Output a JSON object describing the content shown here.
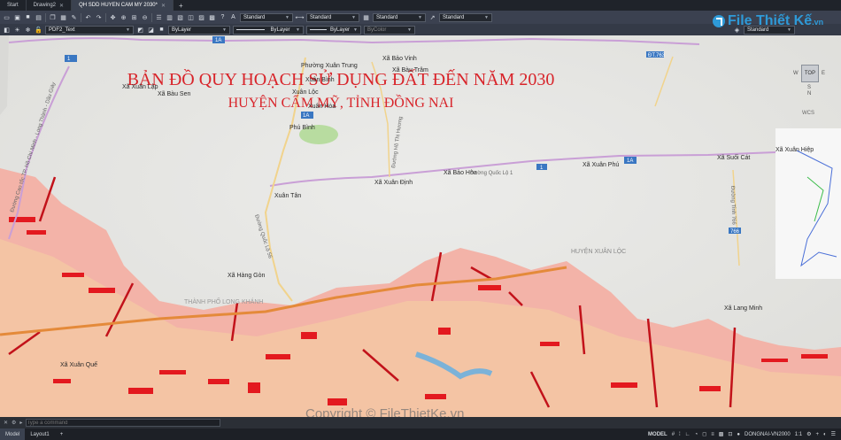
{
  "tabs": [
    {
      "label": "Start",
      "active": false
    },
    {
      "label": "Drawing2",
      "active": false
    },
    {
      "label": "QH SDD HUYEN CAM MY 2030*",
      "active": true
    }
  ],
  "toolbar1": {
    "text_style": "Standard",
    "dim_style": "Standard",
    "table_style": "Standard",
    "mleader_style": "Standard"
  },
  "toolbar2": {
    "layer": "PDF2_Text",
    "color": "ByLayer",
    "linetype": "ByLayer",
    "lineweight": "ByLayer",
    "plotstyle": "ByColor",
    "visual_style": "Standard"
  },
  "map": {
    "title_line1": "BẢN ĐỒ QUY HOẠCH SỬ DỤNG ĐẤT ĐẾN NĂM 2030",
    "title_line2": "HUYỆN CẨM MỸ, TỈNH ĐỒNG NAI",
    "places": {
      "xuan_trung": "Phường Xuân Trung",
      "bao_vinh": "Xã Bảo Vinh",
      "bau_tram": "Xã Bàu Trâm",
      "xuan_binh": "Xuân Bình",
      "xuan_loc": "Xuân Lộc",
      "xuan_hoa": "Xuân Hòa",
      "xuan_lap": "Xã Xuân Lập",
      "bau_sen": "Xã Bàu Sen",
      "phu_binh": "Phú Bình",
      "bao_hoa": "Xã Bảo Hòa",
      "xuan_dinh": "Xã Xuân Định",
      "xuan_phu": "Xã Xuân Phú",
      "suoi_cat": "Xã Suối Cát",
      "xuan_hiep": "Xã Xuân Hiệp",
      "xuan_tan": "Xuân Tân",
      "hang_gon": "Xã Hàng Gòn",
      "lang_minh": "Xã Lang Minh",
      "xuan_quy": "Xã Xuân Quế",
      "huyen_xuan_loc": "HUYỆN XUÂN LỘC",
      "tp_long_khanh": "THÀNH PHỐ LONG KHÁNH"
    },
    "roads": {
      "hcm_long_thanh": "Đường Cao tốc TP. Hồ Chí Minh - Long Thành - Dầu Giây",
      "ho_thi_huong": "Đường Hồ Thị Hương",
      "ql1": "Đường Quốc Lộ 1",
      "ql56": "Đường Quốc Lộ 56",
      "dt763": "ĐT.763",
      "dt766": "Đường Tỉnh 766",
      "shield_1a": "1A",
      "shield_1": "1",
      "shield_766": "766"
    }
  },
  "viewcube": {
    "top": "TOP",
    "n": "N",
    "s": "S",
    "e": "E",
    "w": "W",
    "wcs": "WCS"
  },
  "logo": {
    "brand": "File Thiết Kế",
    "suffix": ".vn"
  },
  "copyright": "Copyright © FileThietKe.vn",
  "command": {
    "placeholder": "Type a command"
  },
  "layout_tabs": [
    "Model",
    "Layout1"
  ],
  "status": {
    "model": "MODEL",
    "coord_system": "DONGNAI-VN2000",
    "scale": "1:1"
  },
  "colors": {
    "accent": "#2e9ad8",
    "title": "#d8242a",
    "planned_land": "#f3b3a8",
    "road": "#c99fd6"
  }
}
